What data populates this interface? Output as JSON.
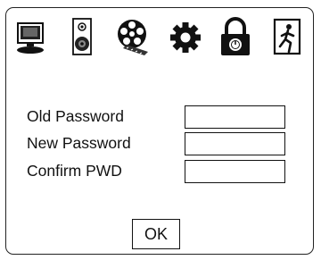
{
  "toolbar": {
    "icons": [
      "monitor-icon",
      "speaker-icon",
      "film-reel-icon",
      "gear-icon",
      "padlock-icon",
      "exit-door-icon"
    ]
  },
  "form": {
    "old_password_label": "Old Password",
    "new_password_label": "New Password",
    "confirm_password_label": "Confirm PWD",
    "old_password_value": "",
    "new_password_value": "",
    "confirm_password_value": ""
  },
  "actions": {
    "ok_label": "OK"
  }
}
